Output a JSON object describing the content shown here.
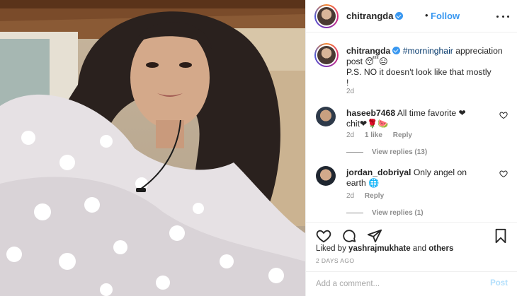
{
  "header": {
    "username": "chitrangda",
    "dot": "•",
    "follow_label": "Follow"
  },
  "caption": {
    "username": "chitrangda",
    "hashtag": "#morninghair",
    "text_line1": "appreciation post 😴😑",
    "text_line2": "P.S. NO it doesn't look like that mostly",
    "text_line3": "!",
    "time": "2d"
  },
  "comments": [
    {
      "username": "haseeb7468",
      "text": "All time favorite ❤",
      "text_cont": "chit❤🌹🍉",
      "time": "2d",
      "likes": "1 like",
      "reply": "Reply",
      "view_replies": "View replies (13)"
    },
    {
      "username": "jordan_dobriyal",
      "text": "Only angel on",
      "text_cont": "earth 🌐",
      "time": "2d",
      "reply": "Reply",
      "view_replies": "View replies (1)"
    }
  ],
  "likes": {
    "prefix": "Liked by",
    "user": "yashrajmukhate",
    "and": "and",
    "others": "others"
  },
  "post_age": "2 DAYS AGO",
  "comment_input": {
    "placeholder": "Add a comment...",
    "post_label": "Post"
  },
  "icons": [
    "more-options-icon",
    "verified-icon",
    "heart-icon",
    "comment-icon",
    "share-icon",
    "bookmark-icon"
  ],
  "colors": {
    "accent_blue": "#3897f0",
    "post_disabled": "#b2dffc",
    "muted_text": "#8e8e8e",
    "hashtag": "#003569"
  }
}
